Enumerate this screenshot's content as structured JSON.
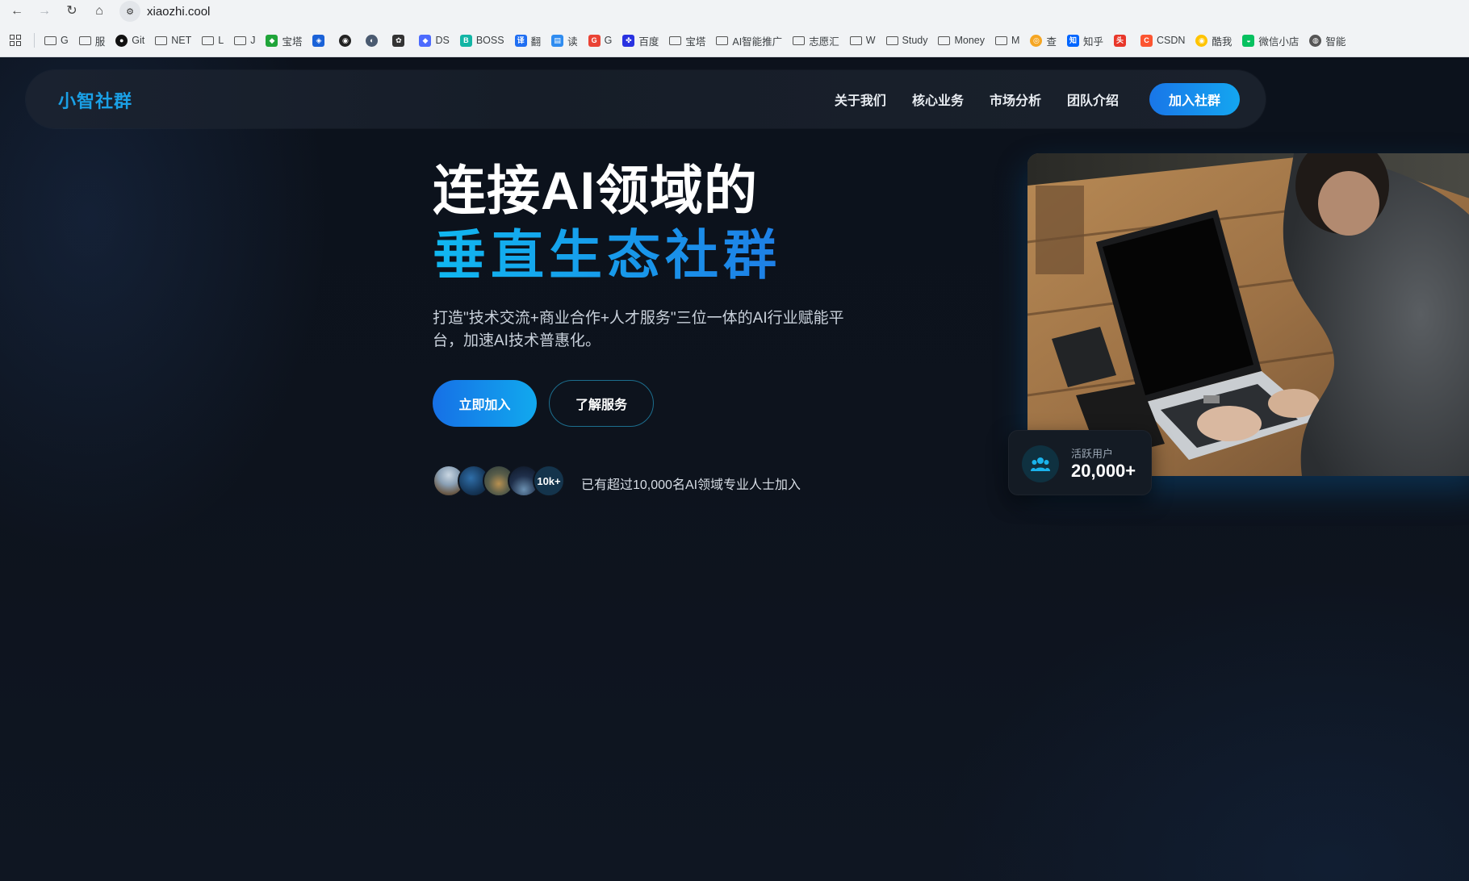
{
  "browser": {
    "url": "xiaozhi.cool",
    "bookmarks": [
      {
        "label": "G",
        "icon": "folder-icon",
        "folder": true
      },
      {
        "label": "服",
        "icon": "folder-icon",
        "folder": true
      },
      {
        "label": "Git",
        "icon": "github-icon",
        "color": "#111111"
      },
      {
        "label": "NET",
        "icon": "folder-icon",
        "folder": true
      },
      {
        "label": "L",
        "icon": "folder-icon",
        "folder": true
      },
      {
        "label": "J",
        "icon": "folder-icon",
        "folder": true
      },
      {
        "label": "宝塔",
        "icon": "shield-icon",
        "color": "#20a53a"
      },
      {
        "label": "",
        "icon": "cube-icon",
        "color": "#1a62d8"
      },
      {
        "label": "",
        "icon": "panda-icon",
        "color": "#222222"
      },
      {
        "label": "",
        "icon": "avatar-icon",
        "color": "#4a5a70"
      },
      {
        "label": "",
        "icon": "openai-icon",
        "color": "#333333"
      },
      {
        "label": "DS",
        "icon": "deepseek-icon",
        "color": "#4d6bfe"
      },
      {
        "label": "BOSS",
        "icon": "boss-icon",
        "color": "#12b5a5"
      },
      {
        "label": "翻",
        "icon": "translate-icon",
        "color": "#1f6ef2"
      },
      {
        "label": "读",
        "icon": "read-icon",
        "color": "#2f8cf0"
      },
      {
        "label": "G",
        "icon": "google-icon",
        "color": "#ea4335"
      },
      {
        "label": "百度",
        "icon": "baidu-icon",
        "color": "#2932e1"
      },
      {
        "label": "宝塔",
        "icon": "folder-icon",
        "folder": true
      },
      {
        "label": "AI智能推广",
        "icon": "folder-icon",
        "folder": true
      },
      {
        "label": "志愿汇",
        "icon": "folder-icon",
        "folder": true
      },
      {
        "label": "W",
        "icon": "folder-icon",
        "folder": true
      },
      {
        "label": "Study",
        "icon": "folder-icon",
        "folder": true
      },
      {
        "label": "Money",
        "icon": "folder-icon",
        "folder": true
      },
      {
        "label": "M",
        "icon": "folder-icon",
        "folder": true
      },
      {
        "label": "查",
        "icon": "search-icon",
        "color": "#f5a623"
      },
      {
        "label": "知乎",
        "icon": "zhihu-icon",
        "color": "#0066ff"
      },
      {
        "label": "",
        "icon": "toutiao-icon",
        "color": "#e8372a"
      },
      {
        "label": "CSDN",
        "icon": "csdn-icon",
        "color": "#fc5531"
      },
      {
        "label": "酷我",
        "icon": "kuwo-icon",
        "color": "#ffc400"
      },
      {
        "label": "微信小店",
        "icon": "wechat-shop-icon",
        "color": "#07c160"
      },
      {
        "label": "智能",
        "icon": "globe-icon",
        "color": "#555555"
      }
    ]
  },
  "nav": {
    "logo": "小智社群",
    "links": [
      "关于我们",
      "核心业务",
      "市场分析",
      "团队介绍"
    ],
    "cta": "加入社群"
  },
  "hero": {
    "title_line1": "连接AI领域的",
    "title_line2": "垂直生态社群",
    "subtitle": "打造\"技术交流+商业合作+人才服务\"三位一体的AI行业赋能平台，加速AI技术普惠化。",
    "primary_button": "立即加入",
    "secondary_button": "了解服务",
    "avatar_count_badge": "10k+",
    "social_proof": "已有超过10,000名AI领域专业人士加入",
    "stat_label": "活跃用户",
    "stat_value": "20,000+"
  },
  "colors": {
    "accent": "#14a6f0",
    "accent_deep": "#1670e6",
    "background": "#0c121c"
  }
}
